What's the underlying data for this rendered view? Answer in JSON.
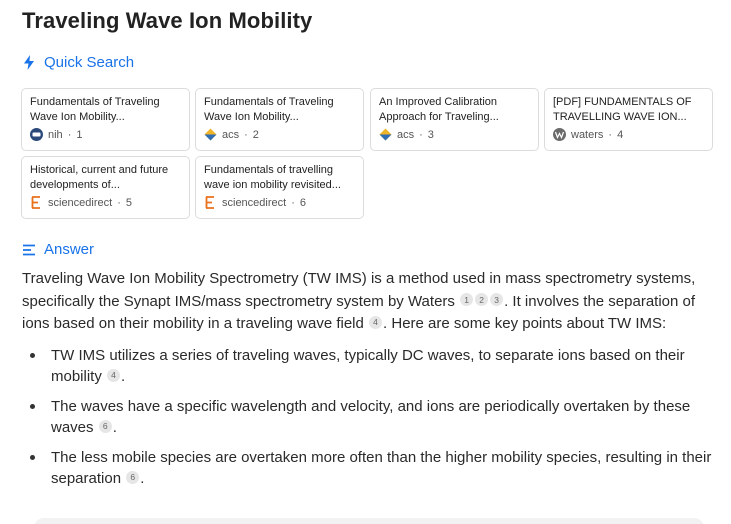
{
  "title": "Traveling Wave Ion Mobility",
  "quick_search": {
    "label": "Quick Search",
    "icon": "lightning-icon",
    "accent": "#1a73e8"
  },
  "cards": [
    {
      "title": "Fundamentals of Traveling Wave Ion Mobility...",
      "source": "nih",
      "num": "1",
      "icon": "nih-icon"
    },
    {
      "title": "Fundamentals of Traveling Wave Ion Mobility...",
      "source": "acs",
      "num": "2",
      "icon": "acs-icon"
    },
    {
      "title": "An Improved Calibration Approach for Traveling...",
      "source": "acs",
      "num": "3",
      "icon": "acs-icon"
    },
    {
      "title": "[PDF] FUNDAMENTALS OF TRAVELLING WAVE ION...",
      "source": "waters",
      "num": "4",
      "icon": "waters-icon"
    },
    {
      "title": "Historical, current and future developments of...",
      "source": "sciencedirect",
      "num": "5",
      "icon": "elsevier-icon"
    },
    {
      "title": "Fundamentals of travelling wave ion mobility revisited...",
      "source": "sciencedirect",
      "num": "6",
      "icon": "elsevier-icon"
    }
  ],
  "answer": {
    "label": "Answer",
    "icon": "list-lines-icon",
    "p1": "Traveling Wave Ion Mobility Spectrometry (TW IMS) is a method used in mass spectrometry systems, specifically the Synapt IMS/mass spectrometry system by Waters",
    "p1_cites": [
      "1",
      "2",
      "3"
    ],
    "p2": ". It involves the separation of ions based on their mobility in a traveling wave field",
    "p2_cite": "4",
    "p3": ". Here are some key points about TW IMS:",
    "bullets": [
      {
        "text": "TW IMS utilizes a series of traveling waves, typically DC waves, to separate ions based on their mobility",
        "cite": "4",
        "end": "."
      },
      {
        "text": "The waves have a specific wavelength and velocity, and ions are periodically overtaken by these waves",
        "cite": "6",
        "end": "."
      },
      {
        "text": "The less mobile species are overtaken more often than the higher mobility species, resulting in their separation",
        "cite": "6",
        "end": "."
      }
    ]
  }
}
